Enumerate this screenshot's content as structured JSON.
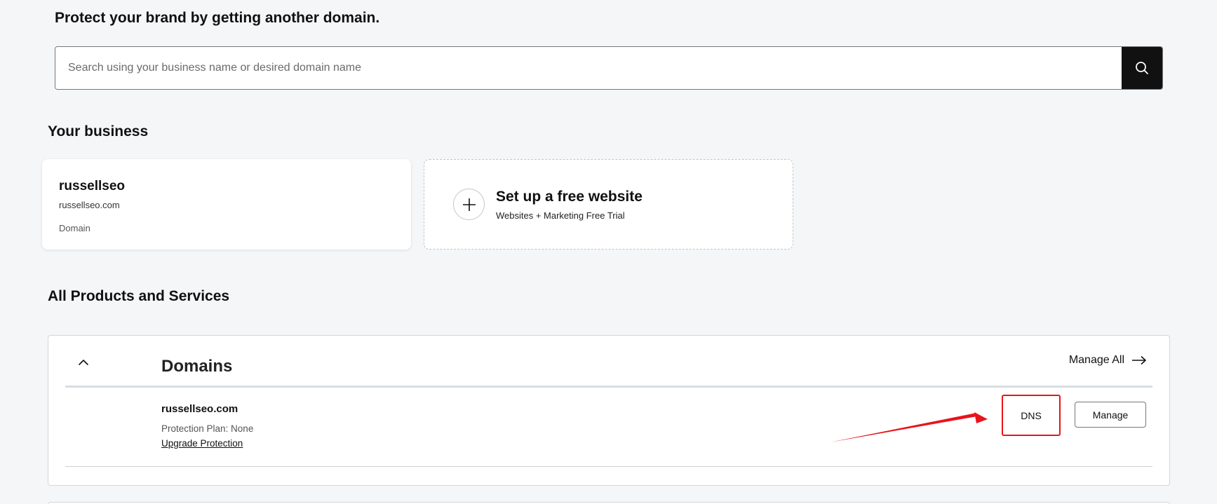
{
  "promo": {
    "title": "Protect your brand by getting another domain.",
    "search_placeholder": "Search using your business name or desired domain name"
  },
  "business": {
    "section_title": "Your business",
    "card": {
      "name": "russellseo",
      "domain": "russellseo.com",
      "type": "Domain"
    },
    "setup": {
      "title": "Set up a free website",
      "subtitle": "Websites + Marketing Free Trial"
    }
  },
  "products": {
    "section_title": "All Products and Services",
    "panel_title": "Domains",
    "manage_all_label": "Manage All",
    "rows": [
      {
        "domain": "russellseo.com",
        "protection": "Protection Plan: None",
        "upgrade_label": "Upgrade Protection",
        "dns_label": "DNS",
        "manage_label": "Manage"
      }
    ]
  },
  "colors": {
    "accent_dark": "#111111",
    "highlight_red": "#e8141c",
    "background": "#f5f6f8"
  },
  "icons": {
    "search": "search-icon",
    "plus": "plus-icon",
    "collapse": "chevron-up-icon",
    "manage_all": "arrow-right-icon"
  }
}
